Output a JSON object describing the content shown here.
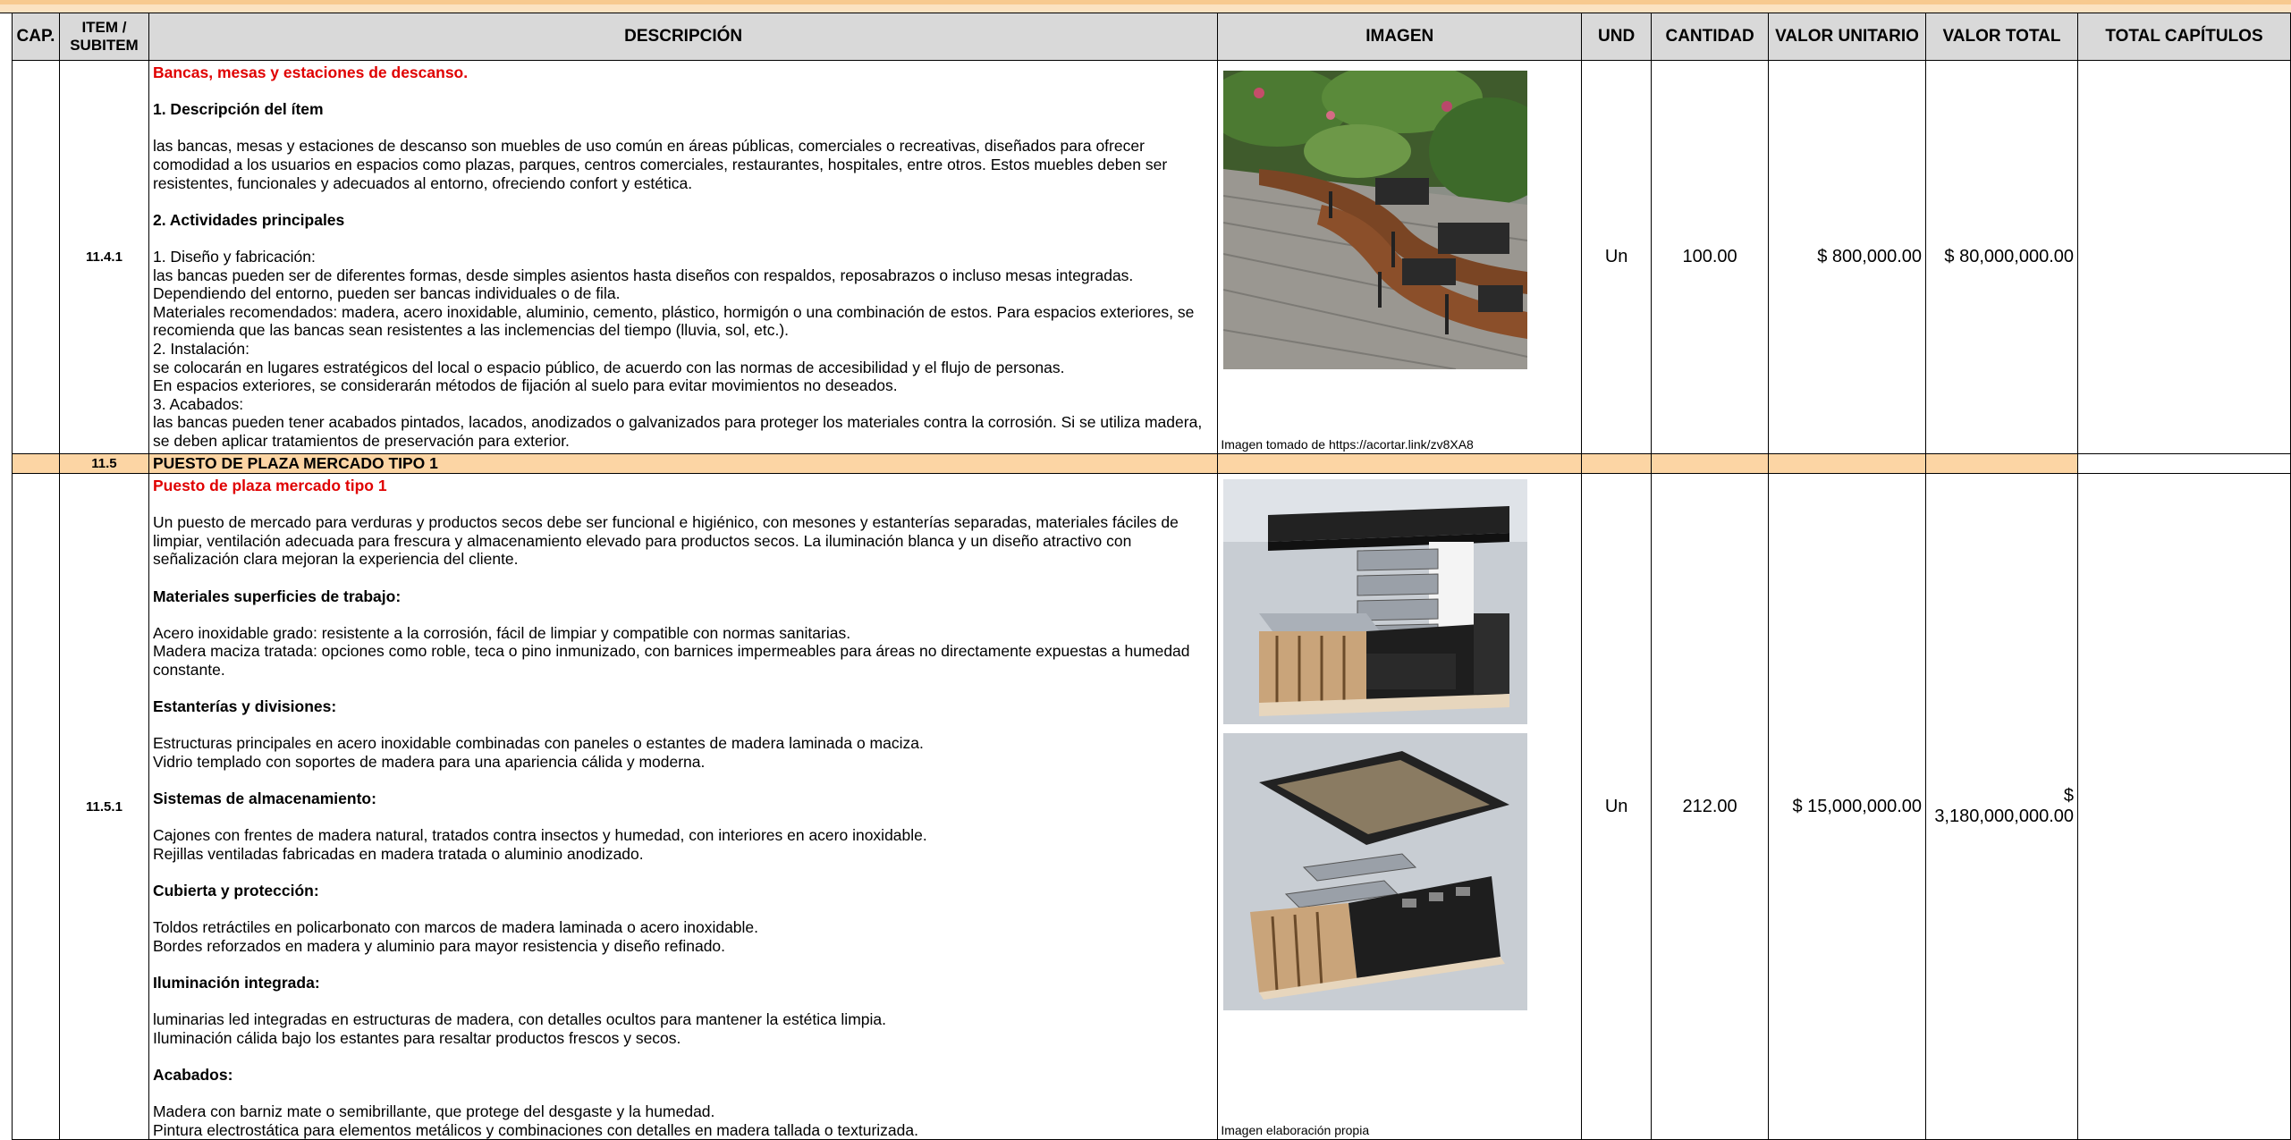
{
  "headers": {
    "cap": "CAP.",
    "item_line1": "ITEM /",
    "item_line2": "SUBITEM",
    "descripcion": "DESCRIPCIÓN",
    "imagen": "IMAGEN",
    "und": "UND",
    "cantidad": "CANTIDAD",
    "valor_unitario": "VALOR UNITARIO",
    "valor_total": "VALOR TOTAL",
    "total_capitulos": "TOTAL CAPÍTULOS"
  },
  "row1": {
    "code": "11.4.1",
    "title": "Bancas, mesas y estaciones de descanso.",
    "h1": "1. Descripción del ítem",
    "p1": "las bancas, mesas y estaciones de descanso son muebles de uso común en áreas públicas, comerciales o recreativas, diseñados para ofrecer comodidad a los usuarios en espacios como plazas, parques, centros comerciales, restaurantes, hospitales, entre otros. Estos muebles deben ser resistentes, funcionales y adecuados al entorno, ofreciendo confort y estética.",
    "h2": "2. Actividades principales",
    "l1": "1. Diseño y fabricación:",
    "l2": "las bancas pueden ser de diferentes formas, desde simples asientos hasta diseños con respaldos, reposabrazos o incluso mesas integradas. Dependiendo del entorno, pueden ser bancas individuales o de fila.",
    "l3": "Materiales recomendados: madera, acero inoxidable, aluminio, cemento, plástico, hormigón o una combinación de estos. Para espacios exteriores, se recomienda que las bancas sean resistentes a las inclemencias del tiempo (lluvia, sol, etc.).",
    "l4": "2. Instalación:",
    "l5": "se colocarán en lugares estratégicos del local o espacio público, de acuerdo con las normas de accesibilidad y el flujo de personas.",
    "l6": "En espacios exteriores, se considerarán métodos de fijación al suelo para evitar movimientos no deseados.",
    "l7": "3. Acabados:",
    "l8": "las bancas pueden tener acabados pintados, lacados, anodizados o galvanizados para proteger los materiales contra la corrosión. Si se utiliza madera, se deben aplicar tratamientos de preservación para exterior.",
    "caption": "Imagen tomado de https://acortar.link/zv8XA8",
    "und": "Un",
    "cantidad": "100.00",
    "valor_unitario": "$ 800,000.00",
    "valor_total": "$ 80,000,000.00"
  },
  "section": {
    "code": "11.5",
    "title": "PUESTO DE PLAZA MERCADO TIPO 1"
  },
  "row2": {
    "code": "11.5.1",
    "title": "Puesto de plaza mercado tipo 1",
    "p1": "Un puesto de mercado para verduras y productos secos debe ser funcional e higiénico, con mesones y estanterías separadas, materiales fáciles de limpiar, ventilación adecuada para frescura y almacenamiento elevado para productos secos. La iluminación blanca y un diseño atractivo con señalización clara mejoran la experiencia del cliente.",
    "h1": "Materiales superficies de trabajo:",
    "a1": "Acero inoxidable grado: resistente a la corrosión, fácil de limpiar y compatible con normas sanitarias.",
    "a2": "Madera maciza tratada: opciones como roble, teca o pino inmunizado, con barnices impermeables para áreas no directamente expuestas a humedad constante.",
    "h2": "Estanterías y divisiones:",
    "b1": "Estructuras principales en acero inoxidable combinadas con paneles o estantes de madera laminada o maciza.",
    "b2": "Vidrio templado con soportes de madera para una apariencia cálida y moderna.",
    "h3": "Sistemas de almacenamiento:",
    "c1": "Cajones con frentes de madera natural, tratados contra insectos y humedad, con interiores en acero inoxidable.",
    "c2": "Rejillas ventiladas fabricadas en madera tratada o aluminio anodizado.",
    "h4": "Cubierta y protección:",
    "d1": "Toldos retráctiles en policarbonato con marcos de madera laminada o acero inoxidable.",
    "d2": "Bordes reforzados en madera y aluminio para mayor resistencia y diseño refinado.",
    "h5": "Iluminación integrada:",
    "e1": "luminarias led integradas en estructuras de madera, con detalles ocultos para mantener la estética limpia.",
    "e2": "Iluminación cálida bajo los estantes para resaltar productos frescos y secos.",
    "h6": "Acabados:",
    "f1": "Madera con barniz mate o semibrillante, que protege del desgaste y la humedad.",
    "f2": "Pintura electrostática para elementos metálicos y combinaciones con detalles en madera tallada o texturizada.",
    "caption": "Imagen elaboración propia",
    "und": "Un",
    "cantidad": "212.00",
    "valor_unitario": "$ 15,000,000.00",
    "valor_total": "$ 3,180,000,000.00"
  },
  "colors": {
    "header_bg": "#d9d9d9",
    "section_bg": "#fcd5a4",
    "title_red": "#e00000"
  }
}
